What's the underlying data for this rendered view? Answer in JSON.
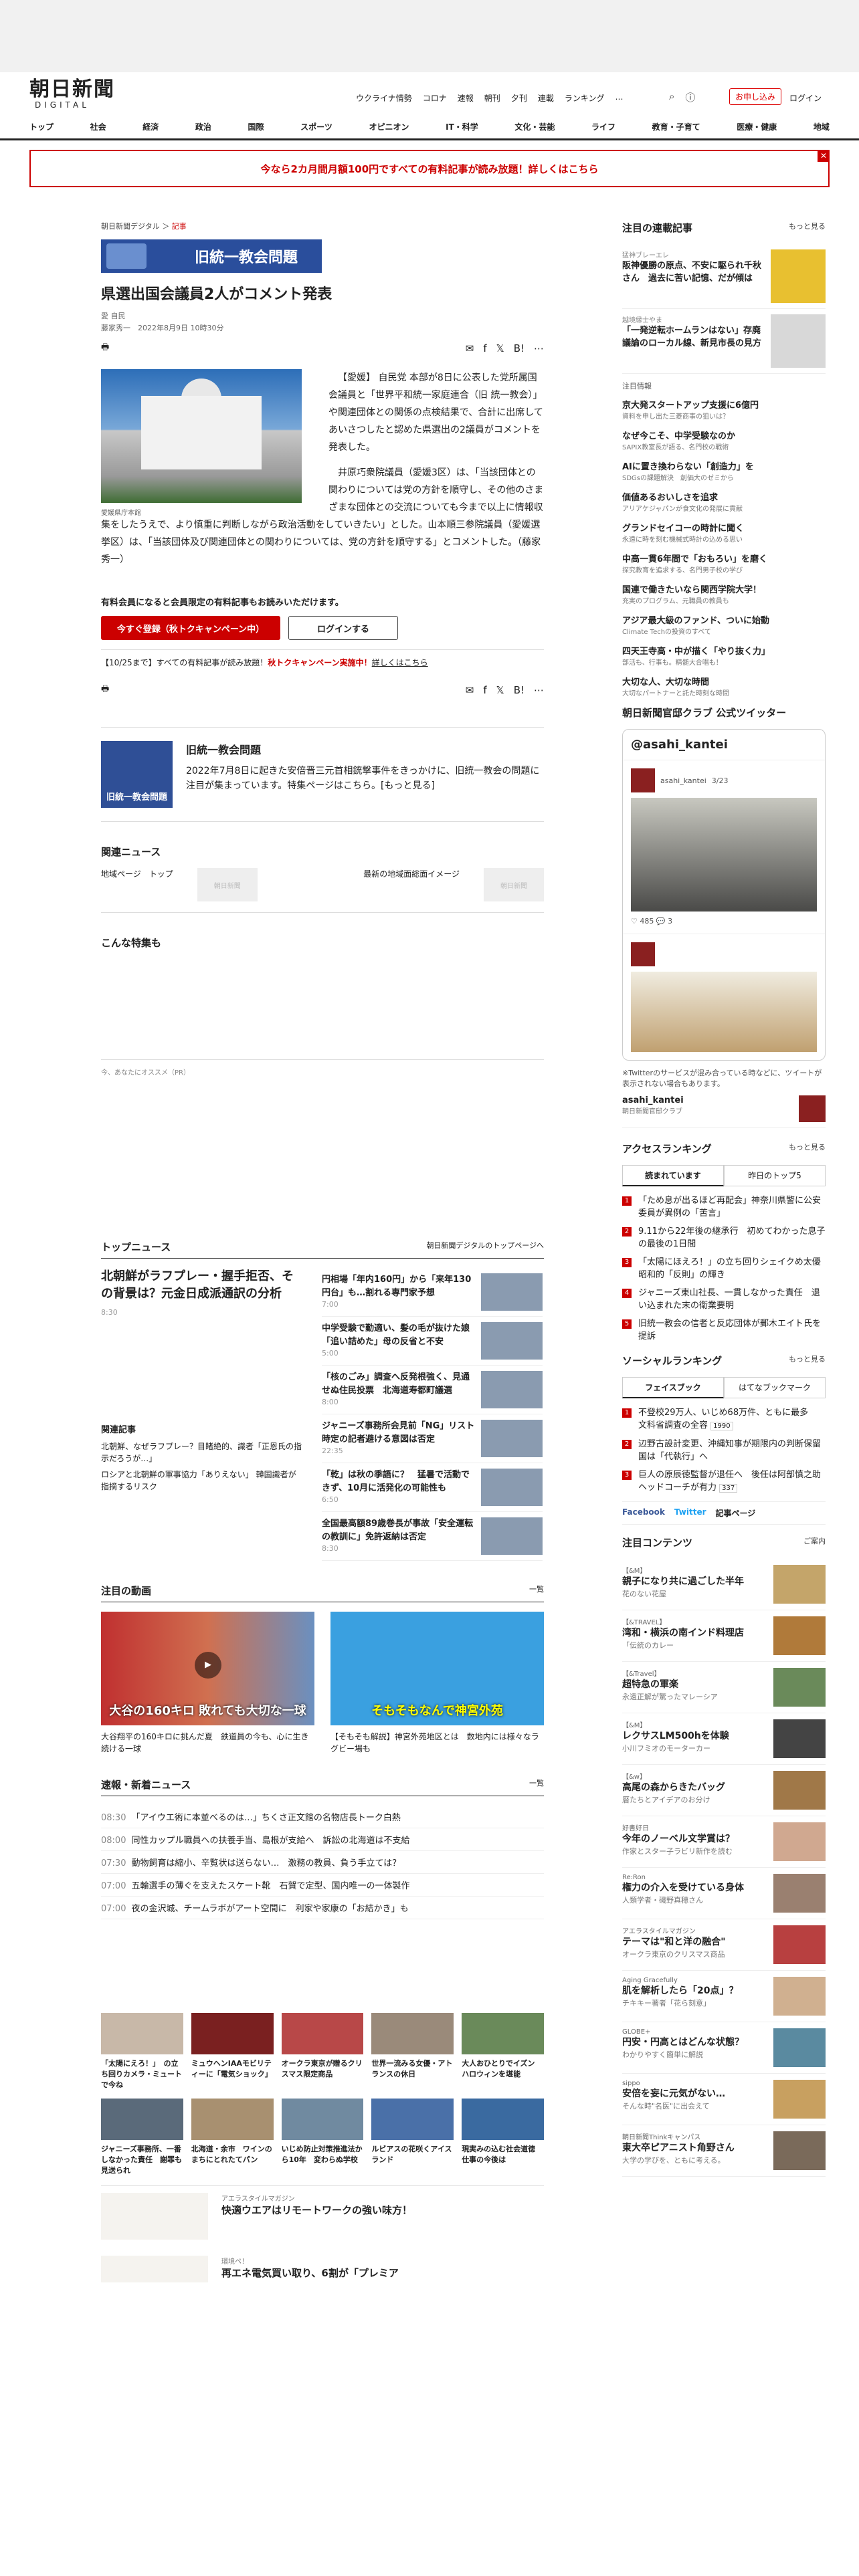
{
  "header": {
    "logo_main": "朝日新聞",
    "logo_sub": "DIGITAL",
    "links": [
      "ウクライナ情勢",
      "コロナ",
      "速報",
      "朝刊",
      "夕刊",
      "連載",
      "ランキング",
      "…"
    ],
    "subscribe": "お申し込み",
    "login": "ログイン"
  },
  "nav": [
    "トップ",
    "社会",
    "経済",
    "政治",
    "国際",
    "スポーツ",
    "オピニオン",
    "IT・科学",
    "文化・芸能",
    "ライフ",
    "教育・子育て",
    "医療・健康",
    "地域"
  ],
  "banner": "今なら2カ月間月額100円ですべての有料記事が読み放題！詳しくはこちら",
  "article": {
    "breadcrumb_site": "朝日新聞デジタル",
    "breadcrumb_sep": "＞",
    "breadcrumb_section": "記事",
    "series": "旧統一教会問題",
    "title": "県選出国会議員2人がコメント発表",
    "area": "愛 自民",
    "byline": "藤家秀一　2022年8月9日 10時30分",
    "list_label": "list",
    "caption": "愛媛県庁本館",
    "p1": "【愛媛】 自民党 本部が8日に公表した党所属国会議員と「世界平和統一家庭連合（旧 統一教会）」や関連団体との関係の点検結果で、合計に出席してあいさつしたと認めた県選出の2議員がコメントを発表した。",
    "p2": "井原巧衆院議員（愛媛3区）は、「当該団体との関わりについては党の方針を順守し、その他のさまざまな団体との交流についても今まで以上に情報収集をしたうえで、より慎重に判断しながら政治活動をしていきたい」とした。山本順三参院議員（愛媛選挙区）は、「当該団体及び関連団体との関わりについては、党の方針を順守する」とコメントした。（藤家秀一）",
    "member_head": "有料会員になると会員限定の有料記事もお読みいただけます。",
    "register": "今すぐ登録（秋トクキャンペーン中）",
    "loginbtn": "ログインする",
    "campaign_pre": "【10/25まで】すべての有料記事が読み放題！",
    "campaign_mid": "秋トクキャンペーン実施中！",
    "campaign_post": "詳しくはこちら"
  },
  "feature": {
    "title": "旧統一教会問題",
    "desc": "2022年7月8日に起きた安倍晋三元首相銃撃事件をきっかけに、旧統一教会の問題に注目が集まっています。特集ページはこちら。[もっと見る]",
    "img": "旧統一教会問題"
  },
  "related": {
    "head": "関連ニュース",
    "items": [
      "地域ページ　トップ",
      "最新の地域面総面イメージ"
    ]
  },
  "special": {
    "head": "こんな特集も"
  },
  "pr": "今、あなたにオススメ（PR）",
  "topnews": {
    "head": "トップニュース",
    "more": "朝日新聞デジタルのトップページへ",
    "lead": "北朝鮮がラフプレー・握手拒否、その背景は？元金日成派通訳の分析",
    "lead_time": "8:30",
    "rel_head": "関連記事",
    "rel": [
      "北朝鮮、なぜラフプレー？目睹絶的、識者「正恩氏の指示だろうが…」",
      "ロシアと北朝鮮の軍事協力「ありえない」 韓国識者が指摘するリスク"
    ],
    "items": [
      {
        "t": "円相場「年内160円」から「来年130円台」も…割れる専門家予想",
        "time": "7:00"
      },
      {
        "t": "中学受験で勤適い、髪の毛が抜けた娘　「追い詰めた」母の反省と不安",
        "time": "5:00"
      },
      {
        "t": "「核のごみ」調査へ反発根強く、見通せぬ住民投票　北海道寿都町議選",
        "time": "8:00"
      },
      {
        "t": "ジャニーズ事務所会見前「NG」リスト　時定の記者避ける意図は否定",
        "time": "22:35"
      },
      {
        "t": "「乾」は秋の季語に？　猛暑で活動できず、10月に活発化の可能性も",
        "time": "6:50"
      },
      {
        "t": "全国最高額89歳巻長が事故「安全運転の教訓に」免許返納は否定",
        "time": "8:30"
      }
    ]
  },
  "videos": {
    "head": "注目の動画",
    "more": "一覧",
    "items": [
      {
        "cap": "大谷翔平の160キロに挑んだ夏　鉄道員の今も、心に生き続ける一球",
        "overlay": "大谷の160キロ 敗れても大切な一球"
      },
      {
        "cap": "【そもそも解説】神宮外苑地区とは　数地内には様々なラグビー場も",
        "overlay": "そもそもなんで神宮外苑"
      }
    ]
  },
  "flash": {
    "head": "速報・新着ニュース",
    "more": "一覧",
    "items": [
      {
        "tm": "08:30",
        "t": "「アイウエ術に本並べるのは…」ちくさ正文館の名物店長トーク白熱"
      },
      {
        "tm": "08:00",
        "t": "同性カップル職員への扶養手当、島根が支給へ　訴訟の北海道は不支給"
      },
      {
        "tm": "07:30",
        "t": "動物飼育は縮小、辛覧状は送らない…　激務の教員、負う手立ては？"
      },
      {
        "tm": "07:00",
        "t": "五輪選手の薄ぐを支えたスケート靴　石賀で定型、国内唯一の一体製作"
      },
      {
        "tm": "07:00",
        "t": "夜の金沢城、チームラボがアート空間に　利家や家康の「お結かき」も"
      }
    ]
  },
  "grid": [
    "「太陽にえろ！」　の立ち回りカメラ・ミュートで今ね",
    "ミュウヘンIAAモビリティーに「電気ショック」",
    "オークラ東京が贈るクリスマス限定商品",
    "世界一流みる女優・アトランスの休日",
    "大人おひとりでイズン　ハロウィンを堪能",
    "ジャニーズ事務所、一番しなかった責任　謝罪も見送られ",
    "北海道・余市　ワインのまちにとれたてパン",
    "いじめ防止対策推進法から10年　変わらぬ学校",
    "ルビアスの花咲くアイスランド",
    "現実みの込む社会道徳　仕事の今後は"
  ],
  "bottom": [
    {
      "k": "アエラスタイルマガジン",
      "t": "快適ウエアはリモートワークの強い味方！"
    },
    {
      "k": "環境ペ！",
      "t": "再エネ電気買い取り、6割が「プレミア"
    }
  ],
  "side": {
    "rensai_head": "注目の連載記事",
    "rensai_more": "もっと見る",
    "rensai": [
      {
        "s": "猛神ブレーエレ",
        "t": "阪神優勝の原点、不安に駆られ千秋さん　過去に苦い記憶、だが傾は"
      },
      {
        "s": "越境縁士やま",
        "t": "「一発逆転ホームランはない」存廃議論のローカル線、新見市長の見方"
      }
    ],
    "notice": "注目情報",
    "pr": [
      {
        "t": "京大発スタートアップ支援に6億円",
        "s": "資料を申し出た三菱商事の狙いは？"
      },
      {
        "t": "なぜ今こそ、中学受験なのか",
        "s": "SAPIX教室長が語る、名門校の戦術"
      },
      {
        "t": "AIに置き換わらない「創造力」を",
        "s": "SDGsの課題解決　創価大のゼミから"
      },
      {
        "t": "価値あるおいしさを追求",
        "s": "アリアケジャパンが食文化の発展に貢献"
      },
      {
        "t": "グランドセイコーの時計に聞く",
        "s": "永遠に時を刻む機械式時計の込める思い"
      },
      {
        "t": "中高一貫6年間で「おもろい」を磨く",
        "s": "探究教育を追求する、名門男子校の学び"
      },
      {
        "t": "国連で働きたいなら関西学院大学！",
        "s": "充実のプログラム、元職員の教員も"
      },
      {
        "t": "アジア最大級のファンド、ついに始動",
        "s": "Climate Techの投資のすべて"
      },
      {
        "t": "四天王寺高・中が描く「やり抜く力」",
        "s": "部活も、行事も。精髄大合唱も！"
      },
      {
        "t": "大切な人、大切な時間",
        "s": "大切なパートナーと託た時刻な時間"
      }
    ],
    "tw_head": "朝日新聞官邸クラブ 公式ツイッター",
    "tw_name": "@asahi_kantei",
    "tw_user": "asahi_kantei",
    "tw_time": "3/23",
    "tw_like": "485",
    "tw_rt": "3",
    "tw_note": "※Twitterのサービスが混み合っている時などに、ツイートが表示されない場合もあります。",
    "tw_foot": "asahi_kantei",
    "tw_foot2": "朝日新聞官邸クラブ",
    "ar_head": "アクセスランキング",
    "ar_more": "もっと見る",
    "ar_tabs": [
      "読まれています",
      "昨日のトップ5"
    ],
    "ar": [
      "「ため息が出るほど再配会」神奈川県警に公安委員が異例の「苦言」",
      "9.11から22年後の継承行　初めてわかった息子の最後の1日間",
      "「太陽にほえろ！」の立ち回りシェイクめ太優　昭和的「反則」の輝き",
      "ジャニーズ東山社長、一貫しなかった責任　退い込まれた末の衛業要明",
      "旧統一教会の信者と反応団体が郵木エイト氏を提訴"
    ],
    "sr_head": "ソーシャルランキング",
    "sr_more": "もっと見る",
    "sr_tabs": [
      "フェイスブック",
      "はてなブックマーク"
    ],
    "sr": [
      "不登校29万人、いじめ68万件、ともに最多　文科省調査の全容",
      "辺野古設計変更、沖縄知事が期限内の判断保留　国は「代執行」へ",
      "巨人の原辰徳監督が退任へ　後任は阿部慎之助ヘッドコーチが有力"
    ],
    "sr_counts": [
      "1990",
      "",
      "337"
    ],
    "follow_fb": "Facebook",
    "follow_tw": "Twitter",
    "follow_more": "記事ページ",
    "cc_head": "注目コンテンツ",
    "cc_more": "ご案内",
    "cc": [
      {
        "k": "【&M】",
        "h": "親子になり共に過ごした半年",
        "s": "花のない花屋",
        "c": "#c4a56a"
      },
      {
        "k": "【&TRAVEL】",
        "h": "湾和・横浜の南インド料理店",
        "s": "「伝統のカレー",
        "c": "#b07a3a"
      },
      {
        "k": "【&Travel】",
        "h": "超特急の軍楽",
        "s": "永遠正解が驚ったマレーシア",
        "c": "#6a8a5a"
      },
      {
        "k": "【&M】",
        "h": "レクサスLM500hを体験",
        "s": "小川フミオのモーターカー",
        "c": "#444"
      },
      {
        "k": "【&w】",
        "h": "高尾の森からきたバッグ",
        "s": "暦たちとアイデアのお分け",
        "c": "#a07848"
      },
      {
        "k": "好書好日",
        "h": "今年のノーベル文学賞は？",
        "s": "作家とスター子ラビリ新作を読む",
        "c": "#d0a890"
      },
      {
        "k": "Re:Ron",
        "h": "権力の介入を受けている身体",
        "s": "人類学者・磯野真穂さん",
        "c": "#9a8070"
      },
      {
        "k": "アエラスタイルマガジン",
        "h": "テーマは\"和と洋の融合\"",
        "s": "オークラ東京のクリスマス商品",
        "c": "#b84040"
      },
      {
        "k": "Aging Gracefully",
        "h": "肌を解析したら「20点」？",
        "s": "チキキー著者「花ら刻意」",
        "c": "#d0b090"
      },
      {
        "k": "GLOBE+",
        "h": "円安・円高とはどんな状態？",
        "s": "わかりやすく簡単に解説",
        "c": "#5a8aa0"
      },
      {
        "k": "sippo",
        "h": "安倍を妄に元気がない…",
        "s": "そんな時\"名医\"に出会えて",
        "c": "#c8a060"
      },
      {
        "k": "朝日新聞Thinkキャンパス",
        "h": "東大卒ピアニスト角野さん",
        "s": "大学の学びを、ともに考える。",
        "c": "#7a6a5a"
      }
    ]
  }
}
